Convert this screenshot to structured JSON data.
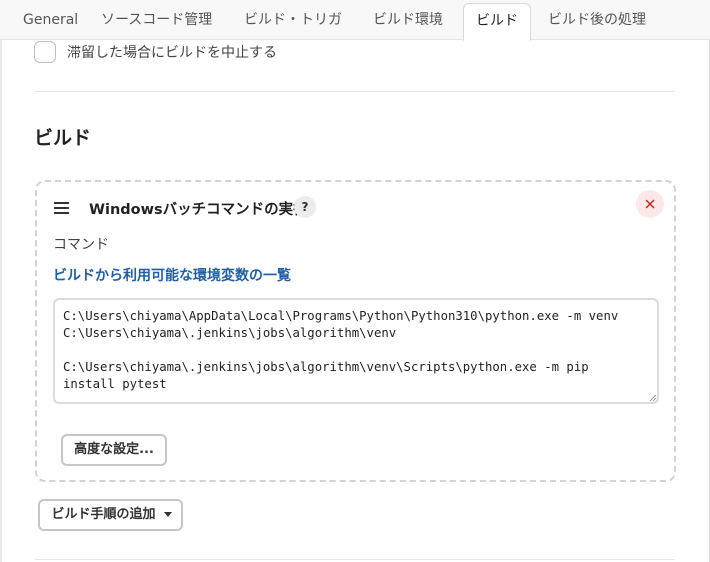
{
  "tabs": [
    {
      "label": "General"
    },
    {
      "label": "ソースコード管理"
    },
    {
      "label": "ビルド・トリガ"
    },
    {
      "label": "ビルド環境"
    },
    {
      "label": "ビルド",
      "active": true
    },
    {
      "label": "ビルド後の処理"
    }
  ],
  "abort_checkbox": {
    "label": "滞留した場合にビルドを中止する",
    "checked": false
  },
  "section": {
    "title": "ビルド"
  },
  "build_step": {
    "title": "Windowsバッチコマンドの実行",
    "help": "?",
    "command_label": "コマンド",
    "env_link": "ビルドから利用可能な環境変数の一覧",
    "command": "C:\\Users\\chiyama\\AppData\\Local\\Programs\\Python\\Python310\\python.exe -m venv\nC:\\Users\\chiyama\\.jenkins\\jobs\\algorithm\\venv\n\nC:\\Users\\chiyama\\.jenkins\\jobs\\algorithm\\venv\\Scripts\\python.exe -m pip\ninstall pytest",
    "advanced_button": "高度な設定..."
  },
  "add_step_button": "ビルド手順の追加",
  "colors": {
    "link": "#1f5fa8",
    "close_bg": "#fde8e8",
    "close_x": "#c62828"
  },
  "icons": [
    "drag-handle-icon",
    "help-icon",
    "close-icon",
    "caret-down-icon"
  ]
}
